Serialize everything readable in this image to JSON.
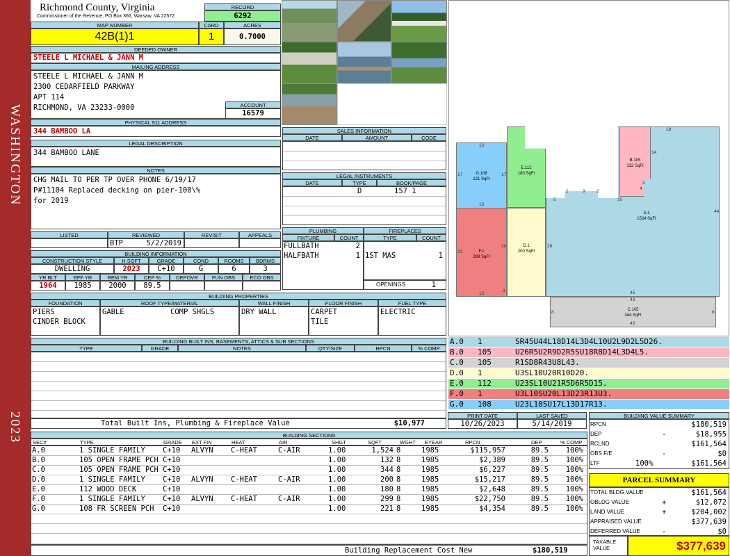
{
  "sidebar": {
    "district": "WASHINGTON",
    "year": "2023"
  },
  "header": {
    "county": "Richmond County, Virginia",
    "commissioner": "Commissioner of the Revenue, PO Box 366, Warsaw, VA 22572"
  },
  "record": {
    "label": "RECORD",
    "value": "6292"
  },
  "map": {
    "label": "MAP NUMBER",
    "value": "42B(1)1"
  },
  "card": {
    "label": "CARD",
    "value": "1"
  },
  "acres": {
    "label": "ACRES",
    "value": "0.7000"
  },
  "owner": {
    "label": "DEEDED OWNER",
    "value": "STEELE L MICHAEL & JANN M"
  },
  "mailing": {
    "label": "MAILING ADDRESS",
    "line1": "STEELE L MICHAEL & JANN M",
    "line2": "2300 CEDARFIELD PARKWAY",
    "line3": "APT 114",
    "line4": "RICHMOND, VA 23233-0000"
  },
  "account": {
    "label": "ACCOUNT",
    "value": "16579"
  },
  "physical": {
    "label": "PHYSICAL 911 ADDRESS",
    "value": "344 BAMBOO LA"
  },
  "legal": {
    "label": "LEGAL DESCRIPTION",
    "value": "344 BAMBOO LANE"
  },
  "notes": {
    "label": "NOTES",
    "line1": "CHG MAIL TO PER TP OVER PHONE 6/19/17",
    "line2": "P#11104 Replaced decking on pier-100\\%",
    "line3": "for 2019"
  },
  "review": {
    "listed": "LISTED",
    "reviewed": "REVIEWED",
    "revisit": "REVISIT",
    "appeals": "APPEALS",
    "reviewer": "BTP",
    "date": "5/2/2019"
  },
  "building_info": {
    "label": "BUILDING INFORMATION",
    "h_style": "CONSTRUCTION STYLE",
    "h_hsqft": "H SQFT",
    "h_grade": "GRADE",
    "h_cond": "COND",
    "h_rooms": "ROOMS",
    "h_bdrms": "BDRMS",
    "style": "DWELLING",
    "hsqft": "2023",
    "grade": "C+10",
    "cond": "G",
    "rooms": "6",
    "bdrms": "3",
    "h_yrblt": "YR BLT",
    "h_effyr": "EFF YR",
    "h_remyr": "REM YR",
    "h_dep": "DEP %",
    "h_depovr": "DEPOVR",
    "h_funobs": "FUN OBS",
    "h_ecoobs": "ECO OBS",
    "yrblt": "1964",
    "effyr": "1985",
    "remyr": "2000",
    "dep": "89.5"
  },
  "properties": {
    "label": "BUILDING PROPERTIES",
    "h_foundation": "FOUNDATION",
    "h_roof": "ROOF TYPE/MATERIAL",
    "h_wall": "WALL FINISH",
    "h_floor": "FLOOR FINISH",
    "h_fuel": "FUEL TYPE",
    "foundation1": "PIERS",
    "foundation2": "CINDER BLOCK",
    "roof_type": "GABLE",
    "roof_mat": "COMP SHGLS",
    "wall": "DRY WALL",
    "floor1": "CARPET",
    "floor2": "TILE",
    "fuel": "ELECTRIC"
  },
  "builtins": {
    "label": "BUILDING BUILT INS, BASEMENTS, ATTICS & SUB SECTIONS",
    "h_type": "TYPE",
    "h_grade": "GRADE",
    "h_notes": "NOTES",
    "h_qty": "QTY/SIZE",
    "h_rpcn": "RPCN",
    "h_comp": "% COMP",
    "total_label": "Total Built Ins, Plumbing & Fireplace Value",
    "total": "$10,977"
  },
  "sales": {
    "label": "SALES INFORMATION",
    "h_date": "DATE",
    "h_amount": "AMOUNT",
    "h_code": "CODE"
  },
  "instruments": {
    "label": "LEGAL INSTRUMENTS",
    "h_date": "DATE",
    "h_type": "TYPE",
    "h_book": "BOOK/PAGE",
    "type": "D",
    "book": "157 1"
  },
  "plumbing": {
    "label": "PLUMBING",
    "h_fixture": "FIXTURE",
    "h_count": "COUNT",
    "rows": [
      {
        "fixture": "FULLBATH",
        "count": "2"
      },
      {
        "fixture": "HALFBATH",
        "count": "1"
      }
    ]
  },
  "fireplaces": {
    "label": "FIREPLACES",
    "h_type": "TYPE",
    "h_count": "COUNT",
    "type": "1ST MAS",
    "count": "1",
    "openings_label": "OPENINGS",
    "openings": "1"
  },
  "sketch": {
    "A": {
      "code": "A.1",
      "area": "1524 SqFt"
    },
    "B": {
      "code": "B.105",
      "area": "132 SqFt"
    },
    "C": {
      "code": "C.105",
      "area": "344 SqFt"
    },
    "D": {
      "code": "D.1",
      "area": "200 SqFt"
    },
    "E": {
      "code": "E.112",
      "area": "180 SqFt"
    },
    "F": {
      "code": "F.1",
      "area": "299 SqFt"
    },
    "G": {
      "code": "G.108",
      "area": "221 SqFt"
    },
    "dims": [
      "18",
      "14",
      "4",
      "3",
      "10",
      "2",
      "9",
      "2",
      "5",
      "44",
      "45",
      "43",
      "43",
      "8",
      "8",
      "26",
      "20",
      "3",
      "13",
      "13",
      "13",
      "23",
      "17",
      "17"
    ]
  },
  "traverses": [
    {
      "code": "A.0",
      "n": "1",
      "path": "SR45U44L18D14L3D4L10U2L9D2L5D26.",
      "color": "#add8e6"
    },
    {
      "code": "B.0",
      "n": "105",
      "path": "U26R5U2R9D2R5SU18R8D14L3D4L5.",
      "color": "#ffb6c1"
    },
    {
      "code": "C.0",
      "n": "105",
      "path": "R1SD8R43U8L43.",
      "color": "#d3d3d3"
    },
    {
      "code": "D.0",
      "n": "1",
      "path": "U3SL10U20R10D20.",
      "color": "#fffacd"
    },
    {
      "code": "E.0",
      "n": "112",
      "path": "U23SL10U21R5D6R5D15.",
      "color": "#90ee90"
    },
    {
      "code": "F.0",
      "n": "1",
      "path": "U3L10SU20L13D23R13U3.",
      "color": "#f08080"
    },
    {
      "code": "G.0",
      "n": "108",
      "path": "U23L10SU17L13D17R13.",
      "color": "#87cefa"
    }
  ],
  "print": {
    "label": "PRINT DATE",
    "value": "10/26/2023"
  },
  "saved": {
    "label": "LAST SAVED",
    "value": "5/14/2019"
  },
  "sections": {
    "label": "BUILDING SECTIONS",
    "headers": [
      "SEC#",
      "TYPE",
      "GRADE",
      "EXT FIN",
      "HEAT",
      "AIR",
      "SHGT",
      "SQFT",
      "WGHT",
      "EYEAR",
      "RPCN",
      "DEP",
      "% COMP"
    ],
    "rows": [
      [
        "A.0",
        "1 SINGLE FAMILY",
        "C+10",
        "ALVYN",
        "C-HEAT",
        "C-AIR",
        "1.00",
        "1,524",
        "8",
        "1985",
        "$115,957",
        "89.5",
        "100%"
      ],
      [
        "B.0",
        "105 OPEN FRAME PCH",
        "C+10",
        "",
        "",
        "",
        "1.00",
        "132",
        "8",
        "1985",
        "$2,389",
        "89.5",
        "100%"
      ],
      [
        "C.0",
        "105 OPEN FRAME PCH",
        "C+10",
        "",
        "",
        "",
        "1.00",
        "344",
        "8",
        "1985",
        "$6,227",
        "89.5",
        "100%"
      ],
      [
        "D.0",
        "1 SINGLE FAMILY",
        "C+10",
        "ALVYN",
        "C-HEAT",
        "C-AIR",
        "1.00",
        "200",
        "8",
        "1985",
        "$15,217",
        "89.5",
        "100%"
      ],
      [
        "E.0",
        "112 WOOD DECK",
        "C+10",
        "",
        "",
        "",
        "1.00",
        "180",
        "8",
        "1985",
        "$2,648",
        "89.5",
        "100%"
      ],
      [
        "F.0",
        "1 SINGLE FAMILY",
        "C+10",
        "ALVYN",
        "C-HEAT",
        "C-AIR",
        "1.00",
        "299",
        "8",
        "1985",
        "$22,750",
        "89.5",
        "100%"
      ],
      [
        "G.0",
        "108 FR SCREEN PCH",
        "C+10",
        "",
        "",
        "",
        "1.00",
        "221",
        "8",
        "1985",
        "$4,354",
        "89.5",
        "100%"
      ]
    ],
    "total_label": "Building Replacement Cost New",
    "total": "$180,519"
  },
  "value_summary": {
    "label": "BUILDING VALUE SUMMARY",
    "rpcn_l": "RPCN",
    "rpcn": "$180,519",
    "dep_l": "DEP",
    "dep_sign": "-",
    "dep": "$18,955",
    "rclnd_l": "RCLND",
    "rclnd": "$161,564",
    "obs_l": "OBS F/E",
    "obs_sign": "-",
    "obs": "$0",
    "ltf_l": "LTF",
    "ltf_pct": "100%",
    "ltf": "$161,564"
  },
  "parcel": {
    "label": "PARCEL SUMMARY",
    "bldg_l": "TOTAL BLDG VALUE",
    "bldg": "$161,564",
    "obldg_l": "OBLDG VALUE",
    "obldg_sign": "+",
    "obldg": "$12,072",
    "land_l": "LAND VALUE",
    "land_sign": "+",
    "land": "$204,002",
    "appr_l": "APPRAISED VALUE",
    "appr": "$377,639",
    "def_l": "DEFERRED VALUE",
    "def_sign": "-",
    "def": "$0",
    "tax_l1": "TAXABLE",
    "tax_l2": "VALUE",
    "tax": "$377,639"
  }
}
